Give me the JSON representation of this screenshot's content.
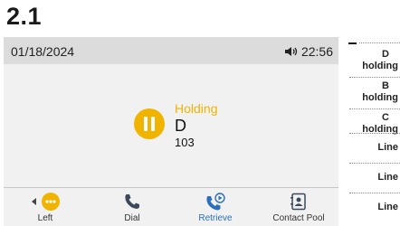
{
  "section": {
    "number": "2.1"
  },
  "status_bar": {
    "date": "01/18/2024",
    "time": "22:56"
  },
  "call": {
    "status": "Holding",
    "name": "D",
    "number": "103"
  },
  "softkeys": [
    {
      "label": "Left",
      "icon": "more-dots-icon"
    },
    {
      "label": "Dial",
      "icon": "handset-icon"
    },
    {
      "label": "Retrieve",
      "icon": "retrieve-handset-icon"
    },
    {
      "label": "Contact Pool",
      "icon": "contacts-book-icon"
    }
  ],
  "side_keys": [
    {
      "line1": "D",
      "line2": "holding"
    },
    {
      "line1": "B",
      "line2": "holding"
    },
    {
      "line1": "C",
      "line2": "holding"
    },
    {
      "line1": "Line",
      "line2": ""
    },
    {
      "line1": "Line",
      "line2": ""
    },
    {
      "line1": "Line",
      "line2": ""
    }
  ],
  "colors": {
    "hold_accent": "#f0b400",
    "retrieve_accent": "#2a6fbd",
    "status_bar_bg": "#dcdcdc",
    "screen_bg": "#f1f1f1"
  }
}
